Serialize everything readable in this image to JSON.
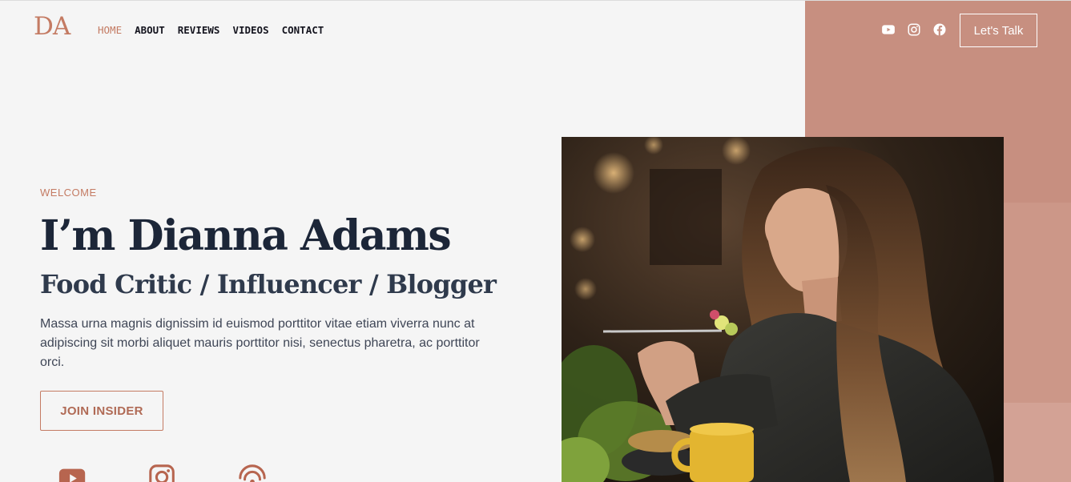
{
  "header": {
    "logo": "DA",
    "nav": [
      {
        "label": "HOME",
        "active": true
      },
      {
        "label": "ABOUT",
        "active": false
      },
      {
        "label": "REVIEWS",
        "active": false
      },
      {
        "label": "VIDEOS",
        "active": false
      },
      {
        "label": "CONTACT",
        "active": false
      }
    ],
    "social_icons": [
      "youtube-icon",
      "instagram-icon",
      "facebook-icon"
    ],
    "cta_label": "Let's Talk"
  },
  "hero": {
    "eyebrow": "WELCOME",
    "title": "I’m Dianna Adams",
    "subtitle": "Food Critic / Influencer / Blogger",
    "description": "Massa urna magnis dignissim id euismod porttitor vitae etiam viverra nunc at adipiscing sit morbi aliquet mauris porttitor nisi, senectus pharetra, ac porttitor orci.",
    "button_label": "JOIN INSIDER",
    "social_icons": [
      "youtube-icon",
      "instagram-icon",
      "podcast-icon"
    ],
    "photo_icon": "woman-eating-photo"
  },
  "colors": {
    "accent": "#c47b63",
    "block_primary": "#c78f80",
    "block_secondary": "#cc9788",
    "block_tertiary": "#d3a295",
    "heading": "#1c2638",
    "background": "#f5f5f5"
  }
}
